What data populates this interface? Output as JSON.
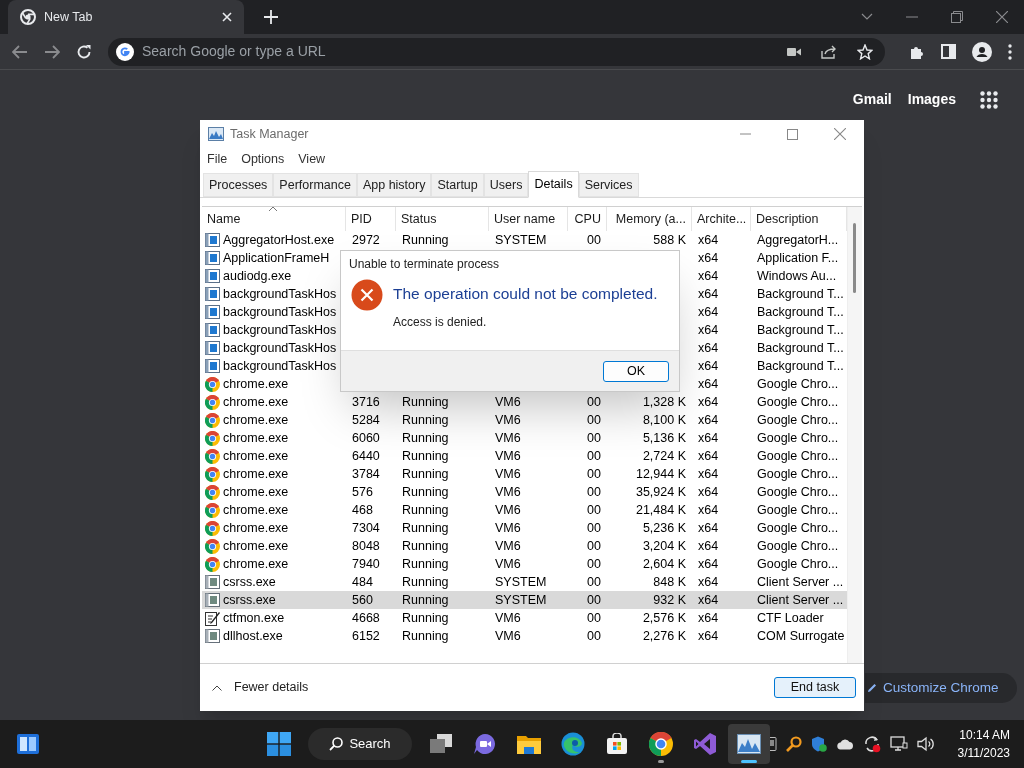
{
  "browser": {
    "tab": {
      "title": "New Tab"
    },
    "omnibox": {
      "placeholder": "Search Google or type a URL"
    },
    "links": [
      "Gmail",
      "Images"
    ],
    "customize_button": "Customize Chrome"
  },
  "task_manager": {
    "title": "Task Manager",
    "menu": [
      "File",
      "Options",
      "View"
    ],
    "tabs": [
      {
        "label": "Processes",
        "selected": false
      },
      {
        "label": "Performance",
        "selected": false
      },
      {
        "label": "App history",
        "selected": false
      },
      {
        "label": "Startup",
        "selected": false
      },
      {
        "label": "Users",
        "selected": false
      },
      {
        "label": "Details",
        "selected": true
      },
      {
        "label": "Services",
        "selected": false
      }
    ],
    "columns": [
      "Name",
      "PID",
      "Status",
      "User name",
      "CPU",
      "Memory (a...",
      "Archite...",
      "Description"
    ],
    "rows": [
      {
        "kind": "window",
        "selected": false,
        "name": "AggregatorHost.exe",
        "pid": "2972",
        "status": "Running",
        "user": "SYSTEM",
        "cpu": "00",
        "memory": "588 K",
        "arch": "x64",
        "description": "AggregatorH..."
      },
      {
        "kind": "window",
        "selected": false,
        "name": "ApplicationFrameH",
        "arch": "x64",
        "description": "Application F..."
      },
      {
        "kind": "window",
        "selected": false,
        "name": "audiodg.exe",
        "arch": "x64",
        "description": "Windows Au..."
      },
      {
        "kind": "window",
        "selected": false,
        "name": "backgroundTaskHos",
        "arch": "x64",
        "description": "Background T..."
      },
      {
        "kind": "window",
        "selected": false,
        "name": "backgroundTaskHos",
        "arch": "x64",
        "description": "Background T..."
      },
      {
        "kind": "window",
        "selected": false,
        "name": "backgroundTaskHos",
        "arch": "x64",
        "description": "Background T..."
      },
      {
        "kind": "window",
        "selected": false,
        "name": "backgroundTaskHos",
        "arch": "x64",
        "description": "Background T..."
      },
      {
        "kind": "window",
        "selected": false,
        "name": "backgroundTaskHos",
        "arch": "x64",
        "description": "Background T..."
      },
      {
        "kind": "chrome",
        "selected": false,
        "name": "chrome.exe",
        "arch": "x64",
        "description": "Google Chro..."
      },
      {
        "kind": "chrome",
        "selected": false,
        "name": "chrome.exe",
        "pid": "3716",
        "status": "Running",
        "user": "VM6",
        "cpu": "00",
        "memory": "1,328 K",
        "arch": "x64",
        "description": "Google Chro..."
      },
      {
        "kind": "chrome",
        "selected": false,
        "name": "chrome.exe",
        "pid": "5284",
        "status": "Running",
        "user": "VM6",
        "cpu": "00",
        "memory": "8,100 K",
        "arch": "x64",
        "description": "Google Chro..."
      },
      {
        "kind": "chrome",
        "selected": false,
        "name": "chrome.exe",
        "pid": "6060",
        "status": "Running",
        "user": "VM6",
        "cpu": "00",
        "memory": "5,136 K",
        "arch": "x64",
        "description": "Google Chro..."
      },
      {
        "kind": "chrome",
        "selected": false,
        "name": "chrome.exe",
        "pid": "6440",
        "status": "Running",
        "user": "VM6",
        "cpu": "00",
        "memory": "2,724 K",
        "arch": "x64",
        "description": "Google Chro..."
      },
      {
        "kind": "chrome",
        "selected": false,
        "name": "chrome.exe",
        "pid": "3784",
        "status": "Running",
        "user": "VM6",
        "cpu": "00",
        "memory": "12,944 K",
        "arch": "x64",
        "description": "Google Chro..."
      },
      {
        "kind": "chrome",
        "selected": false,
        "name": "chrome.exe",
        "pid": "576",
        "status": "Running",
        "user": "VM6",
        "cpu": "00",
        "memory": "35,924 K",
        "arch": "x64",
        "description": "Google Chro..."
      },
      {
        "kind": "chrome",
        "selected": false,
        "name": "chrome.exe",
        "pid": "468",
        "status": "Running",
        "user": "VM6",
        "cpu": "00",
        "memory": "21,484 K",
        "arch": "x64",
        "description": "Google Chro..."
      },
      {
        "kind": "chrome",
        "selected": false,
        "name": "chrome.exe",
        "pid": "7304",
        "status": "Running",
        "user": "VM6",
        "cpu": "00",
        "memory": "5,236 K",
        "arch": "x64",
        "description": "Google Chro..."
      },
      {
        "kind": "chrome",
        "selected": false,
        "name": "chrome.exe",
        "pid": "8048",
        "status": "Running",
        "user": "VM6",
        "cpu": "00",
        "memory": "3,204 K",
        "arch": "x64",
        "description": "Google Chro..."
      },
      {
        "kind": "chrome",
        "selected": false,
        "name": "chrome.exe",
        "pid": "7940",
        "status": "Running",
        "user": "VM6",
        "cpu": "00",
        "memory": "2,604 K",
        "arch": "x64",
        "description": "Google Chro..."
      },
      {
        "kind": "frame",
        "selected": false,
        "name": "csrss.exe",
        "pid": "484",
        "status": "Running",
        "user": "SYSTEM",
        "cpu": "00",
        "memory": "848 K",
        "arch": "x64",
        "description": "Client Server ..."
      },
      {
        "kind": "frame",
        "selected": true,
        "name": "csrss.exe",
        "pid": "560",
        "status": "Running",
        "user": "SYSTEM",
        "cpu": "00",
        "memory": "932 K",
        "arch": "x64",
        "description": "Client Server ..."
      },
      {
        "kind": "pen",
        "selected": false,
        "name": "ctfmon.exe",
        "pid": "4668",
        "status": "Running",
        "user": "VM6",
        "cpu": "00",
        "memory": "2,576 K",
        "arch": "x64",
        "description": "CTF Loader"
      },
      {
        "kind": "frame",
        "selected": false,
        "name": "dllhost.exe",
        "pid": "6152",
        "status": "Running",
        "user": "VM6",
        "cpu": "00",
        "memory": "2,276 K",
        "arch": "x64",
        "description": "COM Surrogate"
      }
    ],
    "footer": {
      "toggle": "Fewer details",
      "button": "End task"
    }
  },
  "dialog": {
    "title": "Unable to terminate process",
    "heading": "The operation could not be completed.",
    "message": "Access is denied.",
    "button": "OK"
  },
  "taskbar": {
    "items": [
      {
        "kind": "start",
        "open": false,
        "selected": false
      },
      {
        "kind": "search",
        "label": "Search",
        "open": false,
        "selected": false
      },
      {
        "kind": "taskview",
        "open": false,
        "selected": false
      },
      {
        "kind": "chat",
        "open": false,
        "selected": false
      },
      {
        "kind": "folder",
        "open": false,
        "selected": false
      },
      {
        "kind": "edge",
        "open": false,
        "selected": false
      },
      {
        "kind": "store",
        "open": false,
        "selected": false
      },
      {
        "kind": "chrome",
        "open": true,
        "selected": false
      },
      {
        "kind": "studio",
        "open": false,
        "selected": false
      },
      {
        "kind": "monitor",
        "open": true,
        "selected": true
      }
    ],
    "time": "10:14 AM",
    "date": "3/11/2023"
  }
}
